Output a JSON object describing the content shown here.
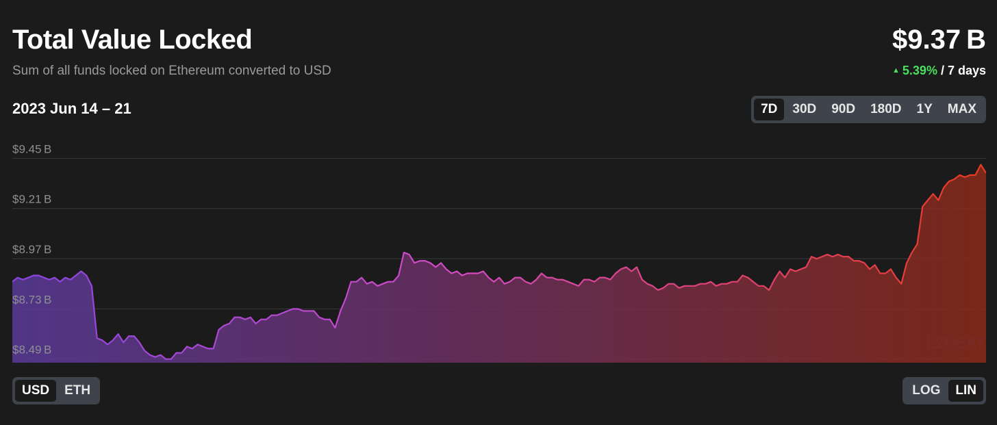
{
  "header": {
    "title": "Total Value Locked",
    "subtitle": "Sum of all funds locked on Ethereum converted to USD",
    "value": "$9.37 B",
    "change_pct": "5.39%",
    "change_period": " / 7 days",
    "change_arrow": "▲"
  },
  "date_range": "2023 Jun 14 – 21",
  "range_buttons": [
    {
      "label": "7D",
      "active": true
    },
    {
      "label": "30D",
      "active": false
    },
    {
      "label": "90D",
      "active": false
    },
    {
      "label": "180D",
      "active": false
    },
    {
      "label": "1Y",
      "active": false
    },
    {
      "label": "MAX",
      "active": false
    }
  ],
  "unit_buttons": [
    {
      "label": "USD",
      "active": true
    },
    {
      "label": "ETH",
      "active": false
    }
  ],
  "scale_buttons": [
    {
      "label": "LOG",
      "active": false
    },
    {
      "label": "LIN",
      "active": true
    }
  ],
  "watermark": "L2BEAT",
  "colors": {
    "background": "#1b1b1b",
    "gradient_start": "#8b45e0",
    "gradient_mid": "#d34bc6",
    "gradient_end": "#ea3a22",
    "positive": "#4ade5d",
    "button_group": "#3f434b"
  },
  "chart_data": {
    "type": "area",
    "title": "Total Value Locked",
    "xlabel": "",
    "ylabel": "",
    "x_range": [
      "2023-06-14",
      "2023-06-21"
    ],
    "ylim": [
      8.44,
      9.52
    ],
    "yticks": [
      8.49,
      8.73,
      8.97,
      9.21,
      9.45
    ],
    "ytick_labels": [
      "$8.49 B",
      "$8.73 B",
      "$8.97 B",
      "$9.21 B",
      "$9.45 B"
    ],
    "grid": true,
    "values": [
      8.86,
      8.88,
      8.87,
      8.88,
      8.89,
      8.89,
      8.88,
      8.87,
      8.88,
      8.86,
      8.88,
      8.87,
      8.89,
      8.91,
      8.89,
      8.84,
      8.59,
      8.58,
      8.56,
      8.58,
      8.61,
      8.57,
      8.6,
      8.6,
      8.57,
      8.53,
      8.51,
      8.5,
      8.51,
      8.49,
      8.49,
      8.52,
      8.52,
      8.55,
      8.54,
      8.56,
      8.55,
      8.54,
      8.54,
      8.63,
      8.65,
      8.66,
      8.69,
      8.69,
      8.68,
      8.69,
      8.66,
      8.68,
      8.68,
      8.7,
      8.7,
      8.71,
      8.72,
      8.73,
      8.73,
      8.72,
      8.72,
      8.72,
      8.69,
      8.68,
      8.68,
      8.64,
      8.72,
      8.78,
      8.86,
      8.86,
      8.88,
      8.85,
      8.86,
      8.84,
      8.85,
      8.86,
      8.86,
      8.89,
      9.0,
      8.99,
      8.95,
      8.96,
      8.96,
      8.95,
      8.93,
      8.95,
      8.92,
      8.9,
      8.91,
      8.89,
      8.9,
      8.9,
      8.9,
      8.91,
      8.88,
      8.86,
      8.88,
      8.85,
      8.86,
      8.88,
      8.88,
      8.86,
      8.85,
      8.87,
      8.9,
      8.88,
      8.88,
      8.87,
      8.87,
      8.86,
      8.85,
      8.84,
      8.87,
      8.87,
      8.86,
      8.88,
      8.88,
      8.87,
      8.9,
      8.92,
      8.93,
      8.91,
      8.93,
      8.87,
      8.85,
      8.84,
      8.82,
      8.83,
      8.85,
      8.85,
      8.83,
      8.84,
      8.84,
      8.84,
      8.85,
      8.85,
      8.86,
      8.84,
      8.85,
      8.85,
      8.86,
      8.86,
      8.89,
      8.88,
      8.86,
      8.84,
      8.84,
      8.82,
      8.87,
      8.91,
      8.88,
      8.92,
      8.91,
      8.92,
      8.93,
      8.98,
      8.97,
      8.98,
      8.99,
      8.98,
      8.99,
      8.98,
      8.98,
      8.96,
      8.96,
      8.95,
      8.92,
      8.94,
      8.9,
      8.9,
      8.92,
      8.88,
      8.85,
      8.95,
      9.0,
      9.04,
      9.22,
      9.25,
      9.28,
      9.25,
      9.31,
      9.34,
      9.35,
      9.37,
      9.36,
      9.37,
      9.37,
      9.42,
      9.38
    ]
  }
}
